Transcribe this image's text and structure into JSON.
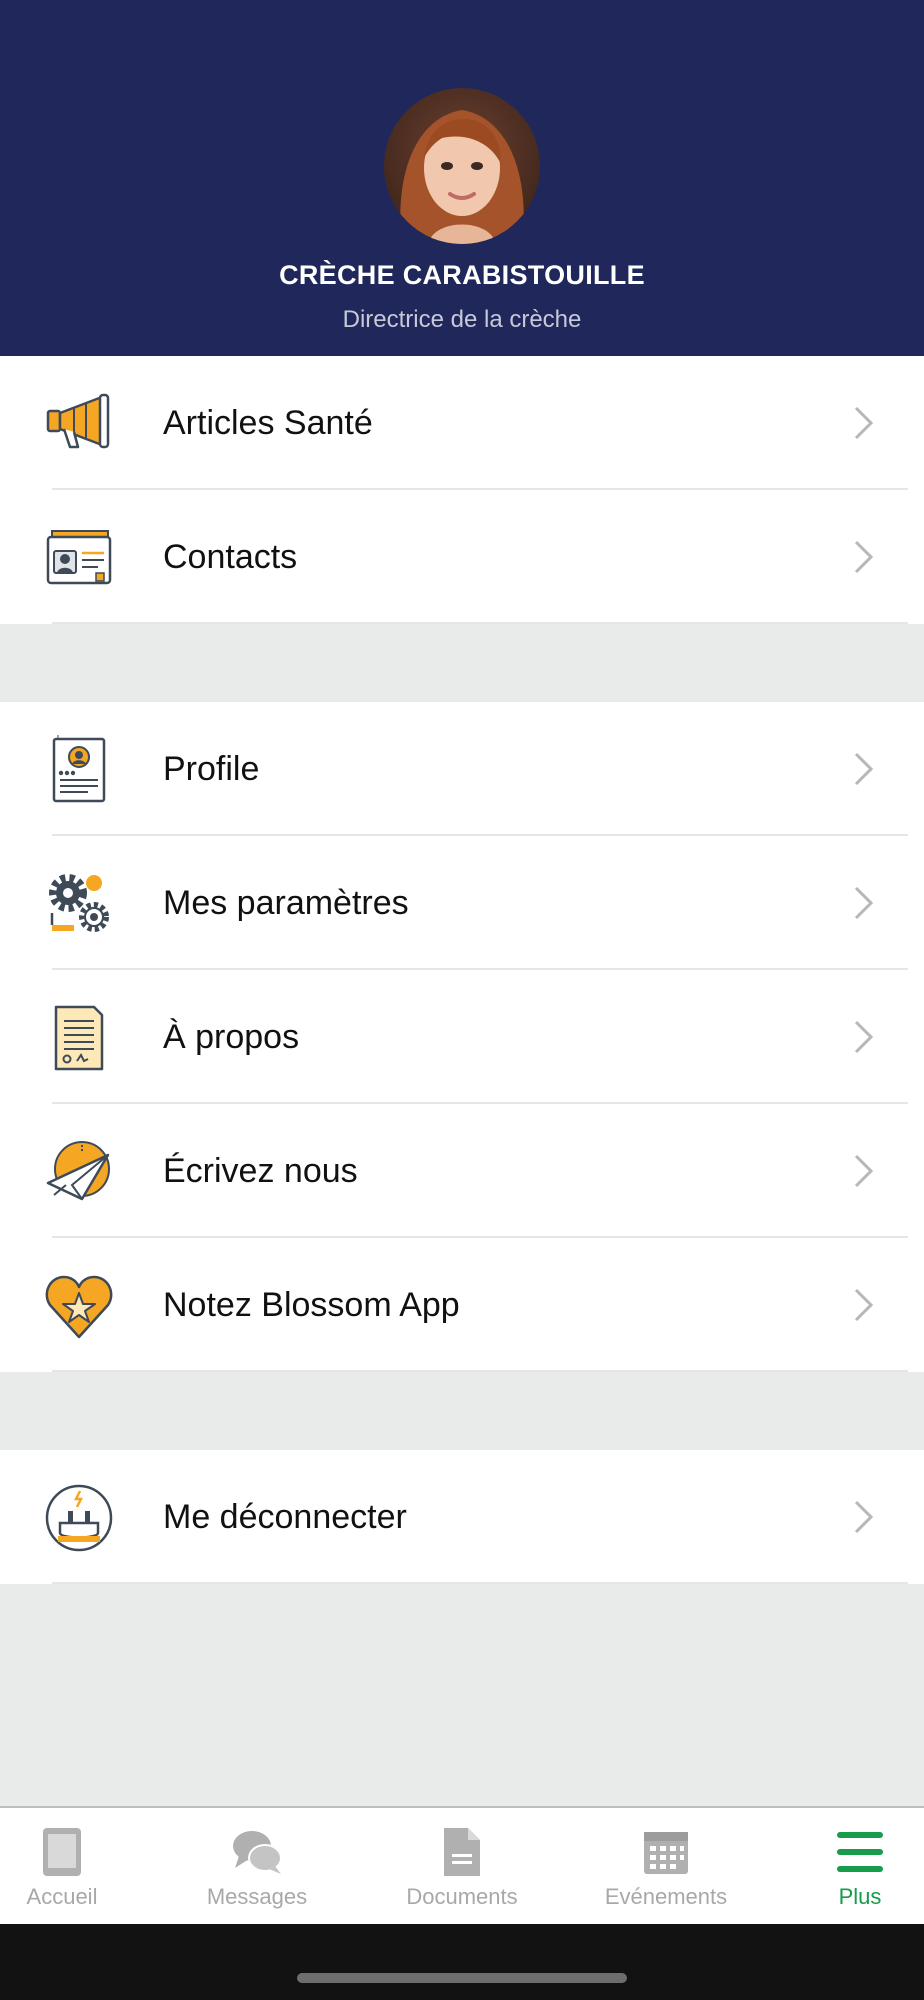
{
  "profile": {
    "name": "CRÈCHE CARABISTOUILLE",
    "role": "Directrice de la crèche"
  },
  "menu": {
    "group1": [
      {
        "label": "Articles Santé",
        "icon": "megaphone-icon"
      },
      {
        "label": "Contacts",
        "icon": "contact-card-icon"
      }
    ],
    "group2": [
      {
        "label": "Profile",
        "icon": "profile-document-icon"
      },
      {
        "label": "Mes paramètres",
        "icon": "gears-icon"
      },
      {
        "label": "À propos",
        "icon": "certificate-icon"
      },
      {
        "label": "Écrivez nous",
        "icon": "paper-plane-icon"
      },
      {
        "label": "Notez Blossom App",
        "icon": "heart-star-icon"
      }
    ],
    "group3": [
      {
        "label": "Me déconnecter",
        "icon": "plug-icon"
      }
    ]
  },
  "tabbar": {
    "tabs": [
      {
        "label": "Accueil",
        "icon": "home-tablet-icon",
        "active": false
      },
      {
        "label": "Messages",
        "icon": "chat-bubbles-icon",
        "active": false
      },
      {
        "label": "Documents",
        "icon": "document-icon",
        "active": false
      },
      {
        "label": "Evénements",
        "icon": "calendar-icon",
        "active": false
      },
      {
        "label": "Plus",
        "icon": "hamburger-menu-icon",
        "active": true
      }
    ]
  },
  "colors": {
    "header_bg": "#20275a",
    "accent": "#f5a623",
    "active_tab": "#169c4a",
    "inactive_tab": "#a8a8a8"
  }
}
